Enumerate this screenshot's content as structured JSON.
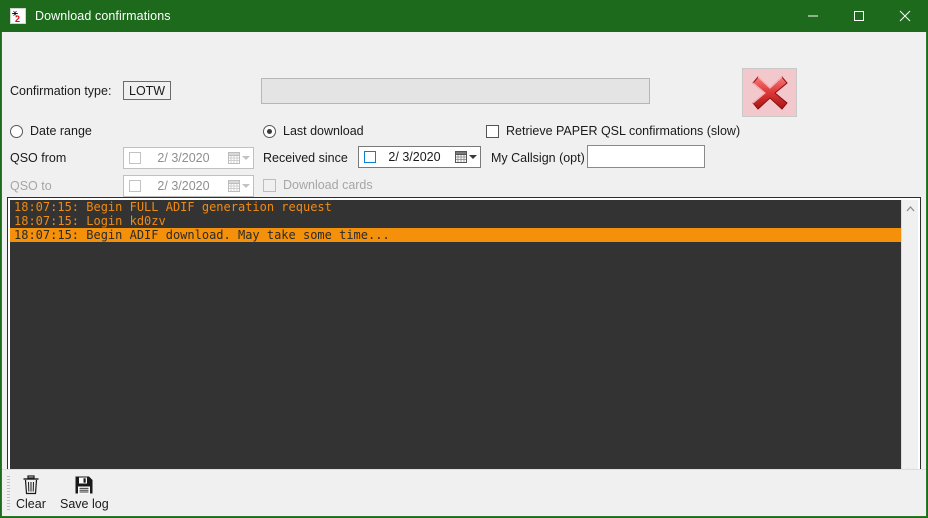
{
  "window": {
    "title": "Download confirmations",
    "icon": "antenna-icon",
    "titlebar_color": "#1d6a1d",
    "controls": {
      "minimize": "minimize-icon",
      "maximize": "maximize-icon",
      "close": "close-icon"
    }
  },
  "form": {
    "confirmation_type_label": "Confirmation type:",
    "confirmation_type_value": "LOTW",
    "progress_value": "",
    "cancel_button": "red-x-icon",
    "date_range_label": "Date range",
    "date_range_selected": false,
    "last_download_label": "Last download",
    "last_download_selected": true,
    "retrieve_paper_label": "Retrieve PAPER QSL confirmations (slow)",
    "retrieve_paper_checked": false,
    "qso_from_label": "QSO from",
    "qso_from_date": "2/  3/2020",
    "qso_from_checked": false,
    "qso_to_label": "QSO to",
    "qso_to_date": "2/  3/2020",
    "qso_to_checked": false,
    "received_since_label": "Received since",
    "received_since_date": "2/  3/2020",
    "received_since_checked": false,
    "download_cards_label": "Download cards",
    "download_cards_checked": false,
    "my_callsign_label": "My Callsign (opt)",
    "my_callsign_value": "",
    "my_callsign_placeholder": ""
  },
  "log": {
    "background": "#333333",
    "text_color": "#f08a12",
    "highlight_color": "#f5900a",
    "lines": [
      {
        "text": "18:07:15: Begin FULL ADIF generation request",
        "selected": false
      },
      {
        "text": "18:07:15: Login kd0zv",
        "selected": false
      },
      {
        "text": "18:07:15: Begin ADIF download. May take some time...",
        "selected": true
      }
    ]
  },
  "scrollbars": {
    "up_arrow": "chevron-up-icon",
    "down_arrow": "chevron-down-icon",
    "left_arrow": "chevron-left-icon",
    "right_arrow": "chevron-right-icon"
  },
  "toolbar": {
    "clear_label": "Clear",
    "clear_icon": "trash-icon",
    "save_label": "Save log",
    "save_icon": "floppy-disk-icon"
  }
}
